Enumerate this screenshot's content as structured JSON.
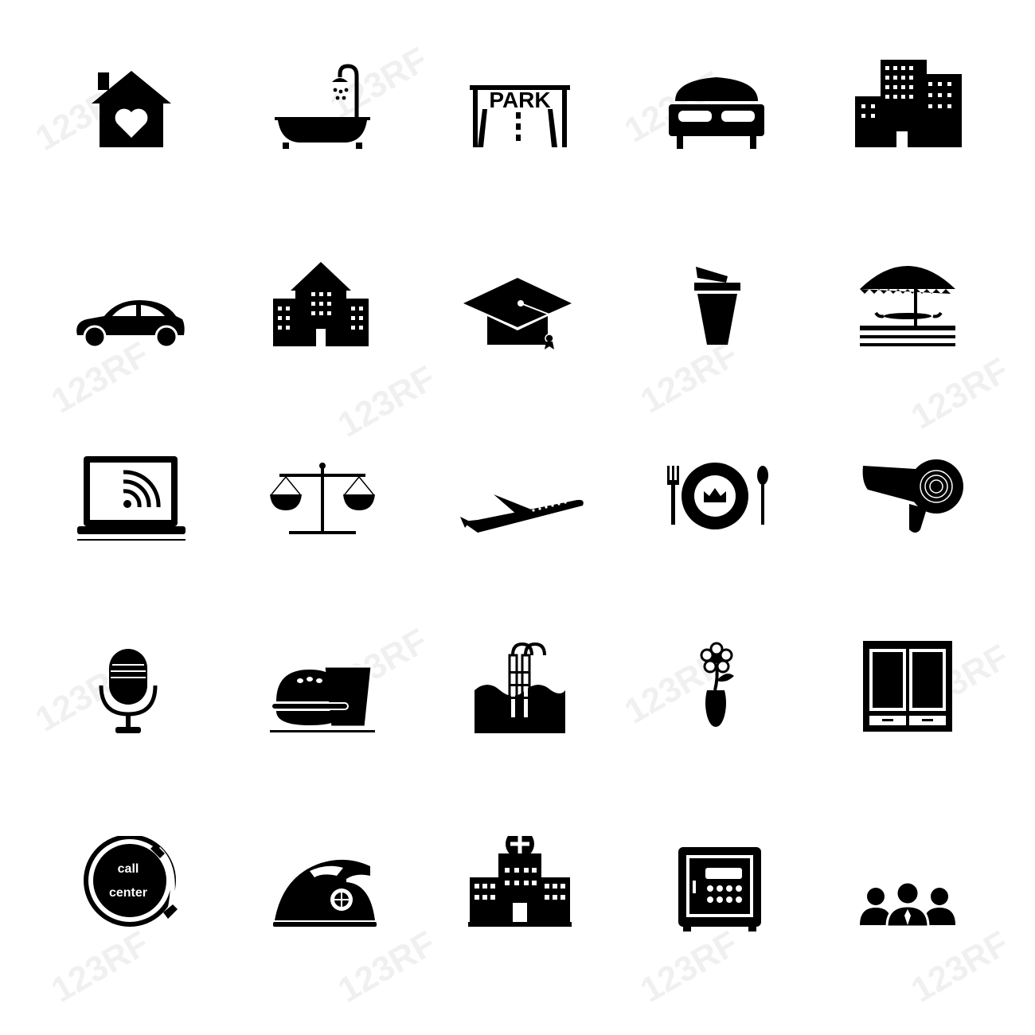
{
  "background": "#ffffff",
  "icon_color": "#000000",
  "watermark": {
    "text": "123RF"
  },
  "grid": {
    "rows": [
      [
        {
          "name": "house-heart-icon"
        },
        {
          "name": "bathtub-shower-icon"
        },
        {
          "name": "parking-icon",
          "label": "PARK"
        },
        {
          "name": "bed-icon"
        },
        {
          "name": "office-buildings-icon"
        }
      ],
      [
        {
          "name": "car-icon"
        },
        {
          "name": "hotel-building-icon"
        },
        {
          "name": "graduation-cap-icon"
        },
        {
          "name": "drink-cup-icon"
        },
        {
          "name": "beach-umbrella-table-icon"
        }
      ],
      [
        {
          "name": "laptop-wifi-icon"
        },
        {
          "name": "balance-scale-icon"
        },
        {
          "name": "airplane-icon"
        },
        {
          "name": "dining-plate-icon"
        },
        {
          "name": "hair-dryer-icon"
        }
      ],
      [
        {
          "name": "microphone-icon"
        },
        {
          "name": "burger-drink-icon"
        },
        {
          "name": "swimming-pool-icon"
        },
        {
          "name": "flower-vase-icon"
        },
        {
          "name": "wardrobe-icon"
        }
      ],
      [
        {
          "name": "call-center-icon",
          "label_1": "call",
          "label_2": "center"
        },
        {
          "name": "iron-icon"
        },
        {
          "name": "hospital-icon"
        },
        {
          "name": "safe-box-icon"
        },
        {
          "name": "business-team-icon"
        }
      ]
    ]
  }
}
